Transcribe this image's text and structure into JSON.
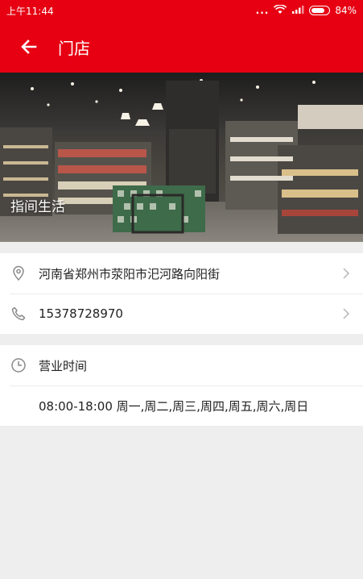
{
  "status_bar": {
    "time": "上午11:44",
    "battery": "84%",
    "battery_level": 0.84,
    "dots": "..."
  },
  "header": {
    "title": "门店",
    "back_icon": "arrow-left-icon",
    "background": "#e60012"
  },
  "store": {
    "name": "指间生活",
    "image": "supermarket-interior-photo"
  },
  "address": {
    "icon": "location-pin-icon",
    "text": "河南省郑州市荥阳市汜河路向阳街"
  },
  "phone": {
    "icon": "phone-icon",
    "text": "15378728970"
  },
  "hours": {
    "icon": "clock-icon",
    "label": "营业时间",
    "value": "08:00-18:00 周一,周二,周三,周四,周五,周六,周日"
  },
  "colors": {
    "accent": "#e60012",
    "page_bg": "#eeeeee"
  }
}
